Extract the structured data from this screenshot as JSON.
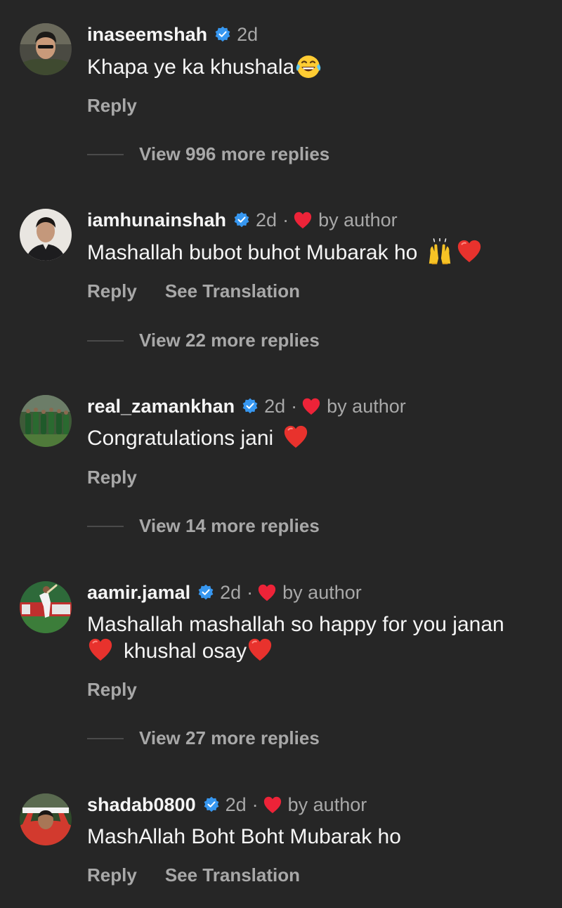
{
  "colors": {
    "background": "#262626",
    "primary_text": "#f5f5f5",
    "secondary_text": "#a8a8a8",
    "verified_blue": "#3797f0",
    "heart_red": "#ed2338"
  },
  "comments": [
    {
      "username": "inaseemshah",
      "time": "2d",
      "liked_by_author": false,
      "liked_label": "",
      "text": "Khapa ye ka khushala",
      "emojis": [
        "laughing-tears-emoji"
      ],
      "reply_label": "Reply",
      "translate_label": "",
      "view_replies_label": "View 996 more replies"
    },
    {
      "username": "iamhunainshah",
      "time": "2d",
      "separator": "·",
      "liked_by_author": true,
      "liked_label": "by author",
      "text": "Mashallah bubot buhot Mubarak ho",
      "emojis": [
        "raising-hands-emoji",
        "red-heart-emoji"
      ],
      "reply_label": "Reply",
      "translate_label": "See Translation",
      "view_replies_label": "View 22 more replies"
    },
    {
      "username": "real_zamankhan",
      "time": "2d",
      "separator": "·",
      "liked_by_author": true,
      "liked_label": "by author",
      "text": "Congratulations jani",
      "emojis": [
        "red-heart-emoji"
      ],
      "reply_label": "Reply",
      "translate_label": "",
      "view_replies_label": "View 14 more replies"
    },
    {
      "username": "aamir.jamal",
      "time": "2d",
      "separator": "·",
      "liked_by_author": true,
      "liked_label": "by author",
      "text_line1": "Mashallah mashallah so happy for you janan",
      "text_line2": "khushal osay",
      "emojis": [
        "red-heart-emoji",
        "red-heart-emoji"
      ],
      "reply_label": "Reply",
      "translate_label": "",
      "view_replies_label": "View 27 more replies"
    },
    {
      "username": "shadab0800",
      "time": "2d",
      "separator": "·",
      "liked_by_author": true,
      "liked_label": "by author",
      "text": "MashAllah Boht Boht Mubarak ho",
      "emojis": [],
      "reply_label": "Reply",
      "translate_label": "See Translation"
    }
  ]
}
